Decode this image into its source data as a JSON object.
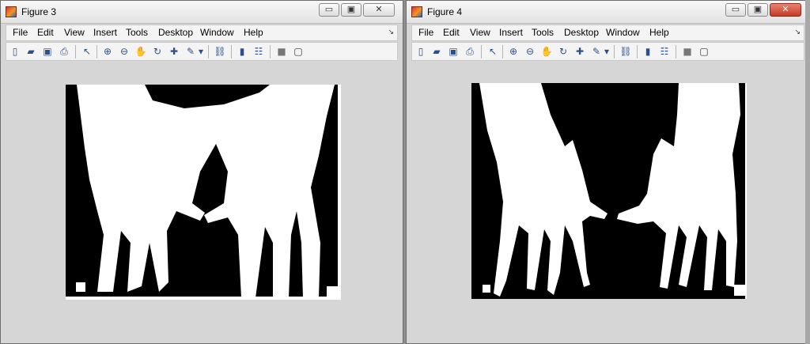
{
  "figures": [
    {
      "title": "Figure 3",
      "controls": {
        "minimize": "▭",
        "restore": "▣",
        "close": "✕"
      },
      "menu": [
        "File",
        "Edit",
        "View",
        "Insert",
        "Tools",
        "Desktop",
        "Window",
        "Help"
      ],
      "dock_arrow": "↘"
    },
    {
      "title": "Figure 4",
      "controls": {
        "minimize": "▭",
        "restore": "▣",
        "close": "✕"
      },
      "menu": [
        "File",
        "Edit",
        "View",
        "Insert",
        "Tools",
        "Desktop",
        "Window",
        "Help"
      ],
      "dock_arrow": "↘"
    }
  ],
  "toolbar_icons": [
    {
      "name": "new-figure-icon",
      "glyph": "▯"
    },
    {
      "name": "open-file-icon",
      "glyph": "▰"
    },
    {
      "name": "save-icon",
      "glyph": "▣"
    },
    {
      "name": "print-icon",
      "glyph": "⎙"
    },
    {
      "name": "edit-plot-icon",
      "glyph": "↖"
    },
    {
      "name": "zoom-in-icon",
      "glyph": "⊕"
    },
    {
      "name": "zoom-out-icon",
      "glyph": "⊖"
    },
    {
      "name": "pan-icon",
      "glyph": "✋"
    },
    {
      "name": "rotate-3d-icon",
      "glyph": "↻"
    },
    {
      "name": "data-cursor-icon",
      "glyph": "✚"
    },
    {
      "name": "brush-icon",
      "glyph": "✎"
    },
    {
      "name": "brush-menu-icon",
      "glyph": "▾"
    },
    {
      "name": "link-plot-icon",
      "glyph": "⛓"
    },
    {
      "name": "colorbar-icon",
      "glyph": "▮"
    },
    {
      "name": "legend-icon",
      "glyph": "☷"
    },
    {
      "name": "hide-tools-icon",
      "glyph": "■"
    },
    {
      "name": "show-tools-icon",
      "glyph": "▢"
    }
  ],
  "colors": {
    "image_foreground": "#ffffff",
    "image_background": "#000000",
    "window_bg": "#d6d6d6"
  }
}
